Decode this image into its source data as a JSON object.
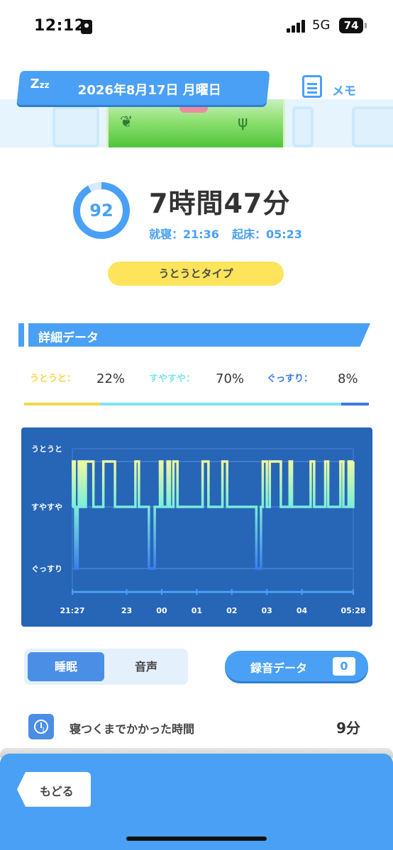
{
  "status_bar": {
    "time": "12:12",
    "network": "5G",
    "battery": "74"
  },
  "header": {
    "zzz": "Z",
    "zzz_small": "zz",
    "date": "2026年8月17日 月曜日",
    "memo_label": "メモ"
  },
  "summary": {
    "score": "92",
    "score_fraction": 0.92,
    "duration": "7時間47分",
    "bedtime": "就寝：21:36",
    "wake": "起床：05:23",
    "sleep_type": "うとうとタイプ"
  },
  "detail": {
    "title": "詳細データ",
    "ratios": [
      {
        "label": "うとうと：",
        "value": "22%",
        "fraction": 0.22,
        "color": "#f5d64a"
      },
      {
        "label": "すやすや：",
        "value": "70%",
        "fraction": 0.7,
        "color": "#7ee3ef"
      },
      {
        "label": "ぐっすり：",
        "value": "8%",
        "fraction": 0.08,
        "color": "#3a7be0"
      }
    ]
  },
  "chart_data": {
    "type": "line",
    "y_categories": [
      "うとうと",
      "すやすや",
      "ぐっすり"
    ],
    "x_ticks": [
      "21:27",
      "23",
      "00",
      "01",
      "02",
      "03",
      "04",
      "05:28"
    ],
    "x_range": [
      "21:27",
      "05:28"
    ],
    "grid": true,
    "series": [
      {
        "values": [
          [
            "21:27",
            "すやすや"
          ],
          [
            "21:28",
            "うとうと"
          ],
          [
            "21:31",
            "すやすや"
          ],
          [
            "21:32",
            "ぐっすり"
          ],
          [
            "21:36",
            "すやすや"
          ],
          [
            "21:38",
            "うとうと"
          ],
          [
            "21:41",
            "すやすや"
          ],
          [
            "21:43",
            "うとうと"
          ],
          [
            "21:46",
            "すやすや"
          ],
          [
            "21:50",
            "うとうと"
          ],
          [
            "22:03",
            "すやすや"
          ],
          [
            "22:20",
            "うとうと"
          ],
          [
            "22:40",
            "すやすや"
          ],
          [
            "23:15",
            "うとうと"
          ],
          [
            "23:21",
            "すやすや"
          ],
          [
            "23:38",
            "ぐっすり"
          ],
          [
            "23:48",
            "すやすや"
          ],
          [
            "23:57",
            "うとうと"
          ],
          [
            "00:01",
            "すやすや"
          ],
          [
            "00:10",
            "うとうと"
          ],
          [
            "00:14",
            "すやすや"
          ],
          [
            "00:20",
            "うとうと"
          ],
          [
            "00:27",
            "すやすや"
          ],
          [
            "01:10",
            "うとうと"
          ],
          [
            "01:20",
            "すやすや"
          ],
          [
            "01:44",
            "うとうと"
          ],
          [
            "01:52",
            "すやすや"
          ],
          [
            "02:42",
            "ぐっすり"
          ],
          [
            "02:50",
            "すやすや"
          ],
          [
            "02:53",
            "うとうと"
          ],
          [
            "03:00",
            "すやすや"
          ],
          [
            "03:05",
            "うとうと"
          ],
          [
            "03:24",
            "すやすや"
          ],
          [
            "03:39",
            "うとうと"
          ],
          [
            "03:43",
            "すやすや"
          ],
          [
            "04:15",
            "うとうと"
          ],
          [
            "04:21",
            "すやすや"
          ],
          [
            "04:40",
            "うとうと"
          ],
          [
            "04:45",
            "すやすや"
          ],
          [
            "05:06",
            "うとうと"
          ],
          [
            "05:11",
            "すやすや"
          ],
          [
            "05:20",
            "うとうと"
          ],
          [
            "05:22",
            "すやすや"
          ],
          [
            "05:24",
            "うとうと"
          ],
          [
            "05:26",
            "すやすや"
          ],
          [
            "05:28",
            "うとうと"
          ]
        ]
      }
    ]
  },
  "tabs": {
    "sleep": "睡眠",
    "audio": "音声"
  },
  "recording": {
    "label": "録音データ",
    "count": "0"
  },
  "latency": {
    "label": "寝つくまでかかった時間",
    "value": "9分"
  },
  "footer": {
    "back_label": "もどる"
  },
  "colors": {
    "accent": "#4aa0f5",
    "chart_bg": "#2765b7",
    "type_pill": "#fde45a"
  }
}
